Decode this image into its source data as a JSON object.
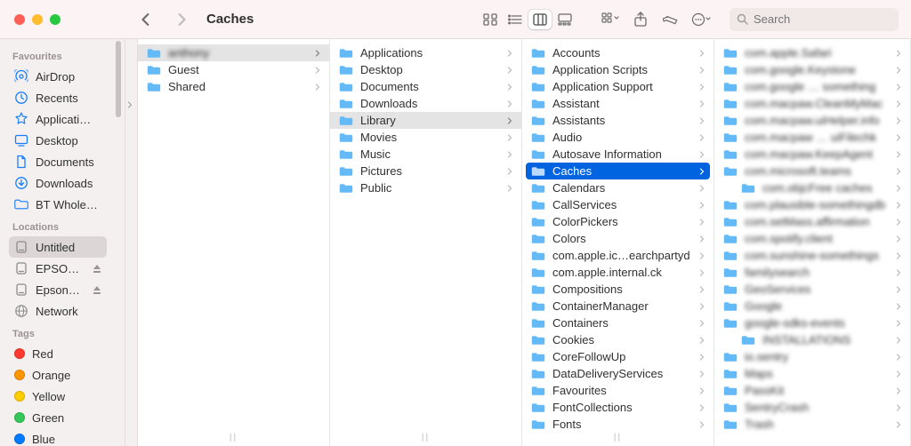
{
  "window": {
    "title": "Caches"
  },
  "search": {
    "placeholder": "Search"
  },
  "sidebar": {
    "sections": [
      {
        "title": "Favourites",
        "items": [
          {
            "label": "AirDrop",
            "icon": "airdrop"
          },
          {
            "label": "Recents",
            "icon": "clock"
          },
          {
            "label": "Applicati…",
            "icon": "apps"
          },
          {
            "label": "Desktop",
            "icon": "desktop"
          },
          {
            "label": "Documents",
            "icon": "doc"
          },
          {
            "label": "Downloads",
            "icon": "download"
          },
          {
            "label": "BT Whole…",
            "icon": "folder"
          }
        ]
      },
      {
        "title": "Locations",
        "items": [
          {
            "label": "Untitled",
            "icon": "disk",
            "selected": true
          },
          {
            "label": "EPSO…",
            "icon": "disk",
            "eject": true
          },
          {
            "label": "Epson…",
            "icon": "disk",
            "eject": true
          },
          {
            "label": "Network",
            "icon": "network"
          }
        ]
      },
      {
        "title": "Tags",
        "items": [
          {
            "label": "Red",
            "tag": "#ff3b30"
          },
          {
            "label": "Orange",
            "tag": "#ff9500"
          },
          {
            "label": "Yellow",
            "tag": "#ffcc00"
          },
          {
            "label": "Green",
            "tag": "#34c759"
          },
          {
            "label": "Blue",
            "tag": "#007aff"
          }
        ]
      }
    ]
  },
  "columns": {
    "c1": [
      {
        "label": "anthony",
        "blur": true,
        "sel": "inactive"
      },
      {
        "label": "Guest"
      },
      {
        "label": "Shared"
      }
    ],
    "c2": [
      {
        "label": "Applications"
      },
      {
        "label": "Desktop"
      },
      {
        "label": "Documents"
      },
      {
        "label": "Downloads"
      },
      {
        "label": "Library",
        "sel": "inactive"
      },
      {
        "label": "Movies"
      },
      {
        "label": "Music"
      },
      {
        "label": "Pictures"
      },
      {
        "label": "Public"
      }
    ],
    "c3": [
      {
        "label": "Accounts"
      },
      {
        "label": "Application Scripts"
      },
      {
        "label": "Application Support"
      },
      {
        "label": "Assistant"
      },
      {
        "label": "Assistants"
      },
      {
        "label": "Audio"
      },
      {
        "label": "Autosave Information"
      },
      {
        "label": "Caches",
        "sel": "active"
      },
      {
        "label": "Calendars"
      },
      {
        "label": "CallServices"
      },
      {
        "label": "ColorPickers"
      },
      {
        "label": "Colors"
      },
      {
        "label": "com.apple.ic…earchpartyd"
      },
      {
        "label": "com.apple.internal.ck"
      },
      {
        "label": "Compositions"
      },
      {
        "label": "ContainerManager"
      },
      {
        "label": "Containers"
      },
      {
        "label": "Cookies"
      },
      {
        "label": "CoreFollowUp"
      },
      {
        "label": "DataDeliveryServices"
      },
      {
        "label": "Favourites"
      },
      {
        "label": "FontCollections"
      },
      {
        "label": "Fonts"
      }
    ],
    "c4": [
      {
        "label": "com.apple.Safari",
        "blur": true
      },
      {
        "label": "com.google.Keystone",
        "blur": true
      },
      {
        "label": "com.google … something",
        "blur": true
      },
      {
        "label": "com.macpaw.CleanMyMac",
        "blur": true
      },
      {
        "label": "com.macpaw.uiHelper.info",
        "blur": true
      },
      {
        "label": "com.macpaw … uiFilechk",
        "blur": true
      },
      {
        "label": "com.macpaw.KeepAgent",
        "blur": true
      },
      {
        "label": "com.microsoft.teams",
        "blur": true
      },
      {
        "label": "com.objcFree caches",
        "blur": true,
        "indent": true
      },
      {
        "label": "com.plausible-somethingdb",
        "blur": true
      },
      {
        "label": "com.setMass.affirmation",
        "blur": true
      },
      {
        "label": "com.spotify.client",
        "blur": true
      },
      {
        "label": "com.sunshine-somethings",
        "blur": true
      },
      {
        "label": "familysearch",
        "blur": true
      },
      {
        "label": "GeoServices",
        "blur": true
      },
      {
        "label": "Google",
        "blur": true
      },
      {
        "label": "google-sdks-events",
        "blur": true
      },
      {
        "label": "INSTALLATIONS",
        "blur": true,
        "indent": true
      },
      {
        "label": "io.sentry",
        "blur": true
      },
      {
        "label": "Maps",
        "blur": true
      },
      {
        "label": "PassKit",
        "blur": true
      },
      {
        "label": "SentryCrash",
        "blur": true
      },
      {
        "label": "Trash",
        "blur": true
      }
    ]
  }
}
